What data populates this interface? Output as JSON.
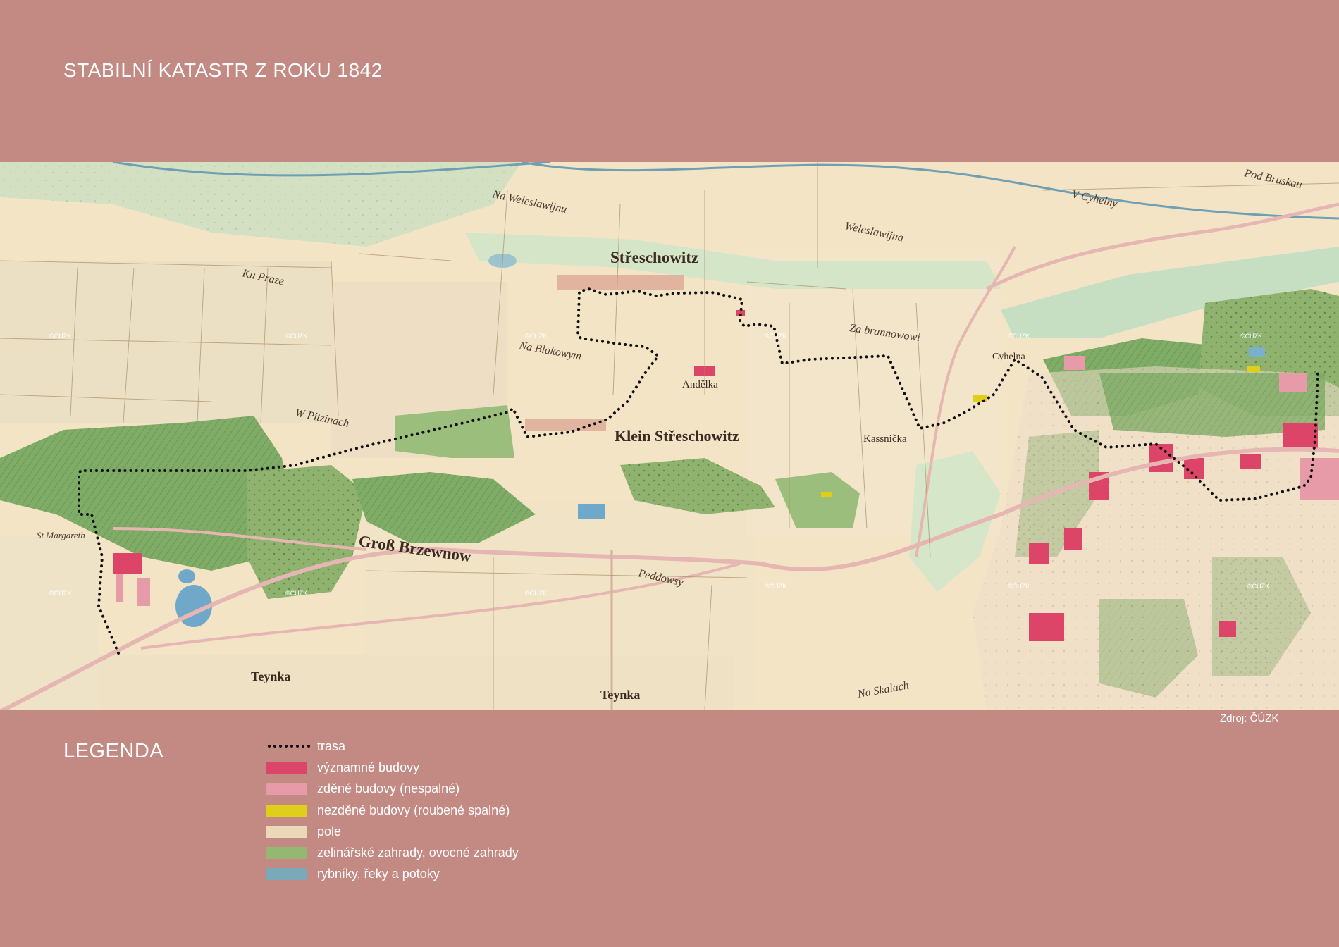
{
  "page": {
    "title": "STABILNÍ KATASTR Z ROKU 1842",
    "source": "Zdroj: ČÚZK"
  },
  "map": {
    "place_labels": [
      "Střeschowitz",
      "Klein Střeschowitz",
      "Groß Brzewnow",
      "Teynka",
      "Teynka",
      "Andělka",
      "Kassnička",
      "Cyhelna",
      "Ku Praze",
      "W Pitzinach",
      "Na Blakowym",
      "Za brannowowi",
      "Na Weleslawijnu",
      "Weleslawijna",
      "V Cyhelny",
      "Pod Bruskau",
      "St Margareth",
      "Peddowsy",
      "Na Skalach"
    ],
    "watermark": "©ČÚZK",
    "colors": {
      "route": "#111111",
      "important_buildings": "#dc4568",
      "brick_buildings": "#e79aa7",
      "wooden_buildings": "#dfce1a",
      "fields": "#ead8b8",
      "gardens": "#94b774",
      "water": "#7aa9b9"
    }
  },
  "legend": {
    "heading": "LEGENDA",
    "items": [
      {
        "label": "trasa",
        "kind": "route",
        "color": "#111111"
      },
      {
        "label": "významné budovy",
        "kind": "swatch",
        "color": "#dc4568"
      },
      {
        "label": "zděné budovy (nespalné)",
        "kind": "swatch",
        "color": "#e79aa7"
      },
      {
        "label": "nezděné budovy (roubené spalné)",
        "kind": "swatch",
        "color": "#dfce1a"
      },
      {
        "label": "pole",
        "kind": "swatch",
        "color": "#ead8b8"
      },
      {
        "label": "zelinářské zahrady, ovocné zahrady",
        "kind": "swatch",
        "color": "#94b774"
      },
      {
        "label": "rybníky, řeky a potoky",
        "kind": "swatch",
        "color": "#7aa9b9"
      }
    ]
  }
}
